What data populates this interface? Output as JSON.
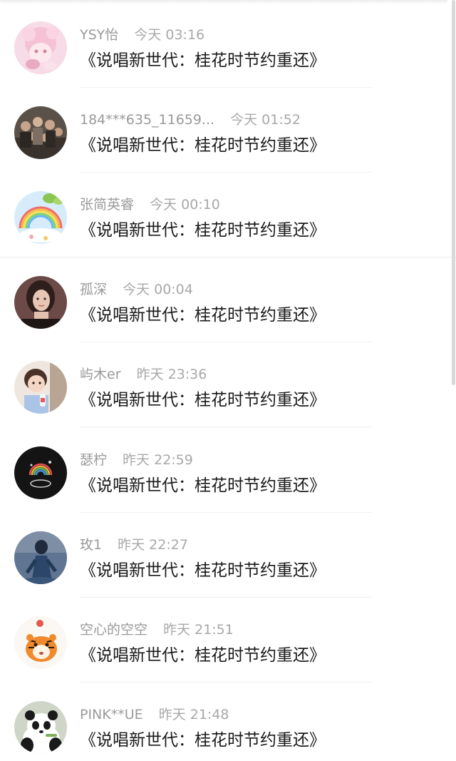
{
  "messages": [
    {
      "name": "YSY怡",
      "time": "今天 03:16",
      "text": "《说唱新世代：桂花时节约重还》",
      "avatar": "anime-pink-girl-avatar"
    },
    {
      "name": "184***635_11659...",
      "time": "今天 01:52",
      "text": "《说唱新世代：桂花时节约重还》",
      "avatar": "group-photo-avatar"
    },
    {
      "name": "张简英睿",
      "time": "今天 00:10",
      "text": "《说唱新世代：桂花时节约重还》",
      "avatar": "rainbow-sky-avatar"
    },
    {
      "name": "孤深",
      "time": "今天 00:04",
      "text": "《说唱新世代：桂花时节约重还》",
      "avatar": "girl-portrait-avatar"
    },
    {
      "name": "屿木er",
      "time": "昨天 23:36",
      "text": "《说唱新世代：桂花时节约重还》",
      "avatar": "child-photo-avatar"
    },
    {
      "name": "瑟柠",
      "time": "昨天 22:59",
      "text": "《说唱新世代：桂花时节约重还》",
      "avatar": "dark-rainbow-avatar"
    },
    {
      "name": "玫1",
      "time": "昨天 22:27",
      "text": "《说唱新世代：桂花时节约重还》",
      "avatar": "blue-figure-avatar"
    },
    {
      "name": "空心的空空",
      "time": "昨天 21:51",
      "text": "《说唱新世代：桂花时节约重还》",
      "avatar": "tiger-avatar"
    },
    {
      "name": "PINK**UE",
      "time": "昨天 21:48",
      "text": "《说唱新世代：桂花时节约重还》",
      "avatar": "panda-avatar"
    }
  ],
  "colors": {
    "name_text": "#9a9a9a",
    "message_text": "#1a1a1a",
    "divider": "#f0f0f0"
  }
}
